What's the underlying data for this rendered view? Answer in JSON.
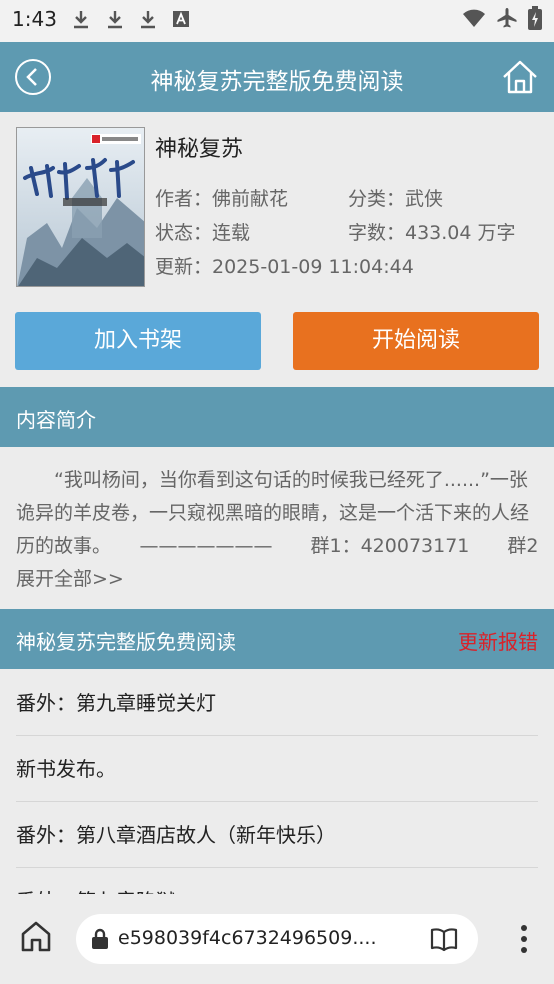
{
  "status_bar": {
    "time": "1:43"
  },
  "header": {
    "title": "神秘复苏完整版免费阅读"
  },
  "book": {
    "title": "神秘复苏",
    "author": "作者：佛前献花",
    "category": "分类：武侠",
    "status": "状态：连载",
    "word_count": "字数：433.04 万字",
    "updated": "更新：2025-01-09 11:04:44"
  },
  "buttons": {
    "add_shelf": "加入书架",
    "start_read": "开始阅读"
  },
  "intro": {
    "heading": "内容简介",
    "text": "“我叫杨间，当你看到这句话的时候我已经死了......”一张诡异的羊皮卷，一只窥视黑暗的眼睛，这是一个活下来的人经历的故事。　　———————　　群1：420073171　　群2 ",
    "more": "展开全部>>"
  },
  "chapters_section": {
    "heading": "神秘复苏完整版免费阅读",
    "report": "更新报错",
    "items": [
      "番外：第九章睡觉关灯",
      "新书发布。",
      "番外：第八章酒店故人（新年快乐）",
      "番外：第七章陷狱"
    ]
  },
  "browser": {
    "url": "e598039f4c6732496509...."
  },
  "colors": {
    "header": "#5e9ab1",
    "shelf_button": "#5aa8d9",
    "read_button": "#e8711f",
    "report": "#d9222a"
  }
}
